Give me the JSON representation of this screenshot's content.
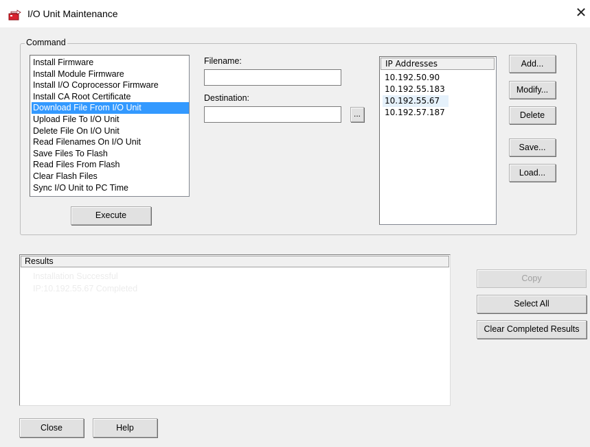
{
  "window": {
    "title": "I/O Unit Maintenance",
    "close_glyph": "✕"
  },
  "command": {
    "group_label": "Command",
    "items": [
      "Install Firmware",
      "Install Module Firmware",
      "Install I/O Coprocessor Firmware",
      "Install CA Root Certificate",
      "Download File From I/O Unit",
      "Upload File To I/O Unit",
      "Delete File On I/O Unit",
      "Read Filenames On I/O Unit",
      "Save Files To Flash",
      "Read Files From Flash",
      "Clear Flash Files",
      "Sync I/O Unit to PC Time"
    ],
    "selected_index": 4,
    "execute_label": "Execute"
  },
  "fields": {
    "filename_label": "Filename:",
    "filename_value": "",
    "destination_label": "Destination:",
    "destination_value": "",
    "browse_label": "..."
  },
  "ip_list": {
    "header": "IP Addresses",
    "items": [
      "10.192.50.90",
      "10.192.55.183",
      "10.192.55.67",
      "10.192.57.187"
    ],
    "hover_index": 2
  },
  "ip_buttons": {
    "add": "Add...",
    "modify": "Modify...",
    "delete": "Delete",
    "save": "Save...",
    "load": "Load..."
  },
  "results": {
    "header": "Results",
    "lines": [
      "Installation Successful",
      "IP:10.192.55.67 Completed"
    ]
  },
  "results_buttons": {
    "copy": "Copy",
    "select_all": "Select All",
    "clear_completed": "Clear Completed Results"
  },
  "footer": {
    "close": "Close",
    "help": "Help"
  },
  "colors": {
    "selection": "#3399ff",
    "button_face": "#e1e1e1",
    "dialog_bg": "#f0f0f0",
    "icon_red": "#d9232e"
  }
}
